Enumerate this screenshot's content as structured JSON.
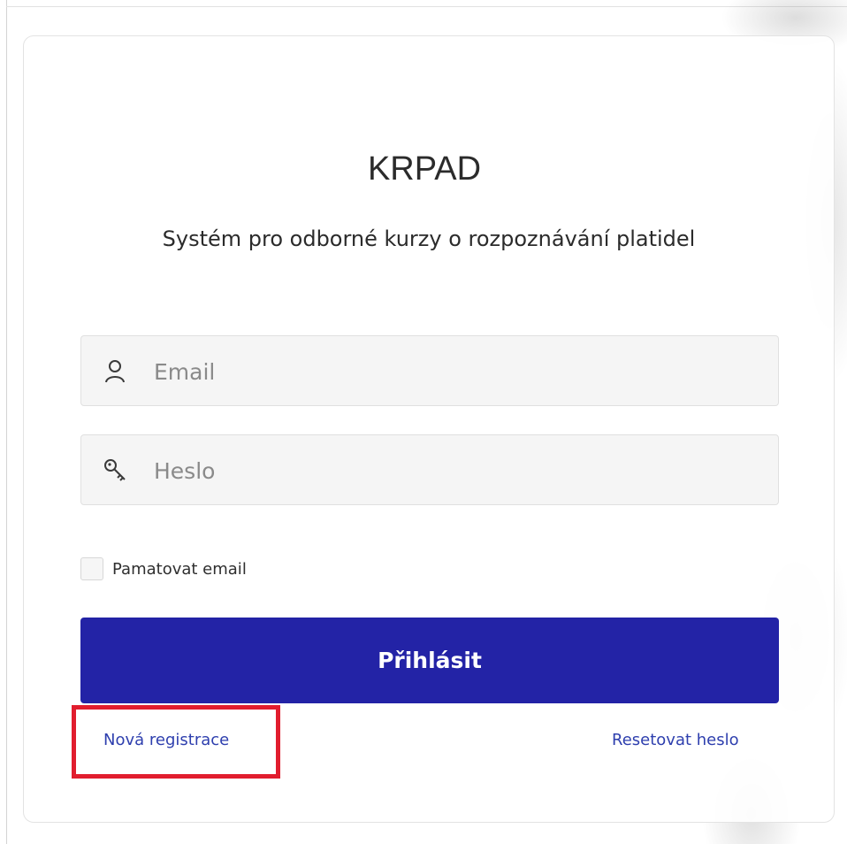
{
  "header": {
    "title": "KRPAD",
    "subtitle": "Systém pro odborné kurzy o rozpoznávání platidel"
  },
  "form": {
    "email": {
      "placeholder": "Email",
      "value": "",
      "icon": "user-icon"
    },
    "password": {
      "placeholder": "Heslo",
      "value": "",
      "icon": "key-icon"
    },
    "remember": {
      "label": "Pamatovat email",
      "checked": false
    },
    "submit_label": "Přihlásit"
  },
  "links": {
    "register": "Nová registrace",
    "reset_password": "Resetovat heslo"
  },
  "colors": {
    "primary_button": "#2323a6",
    "link": "#2e3fae",
    "highlight": "#e11d2e"
  }
}
